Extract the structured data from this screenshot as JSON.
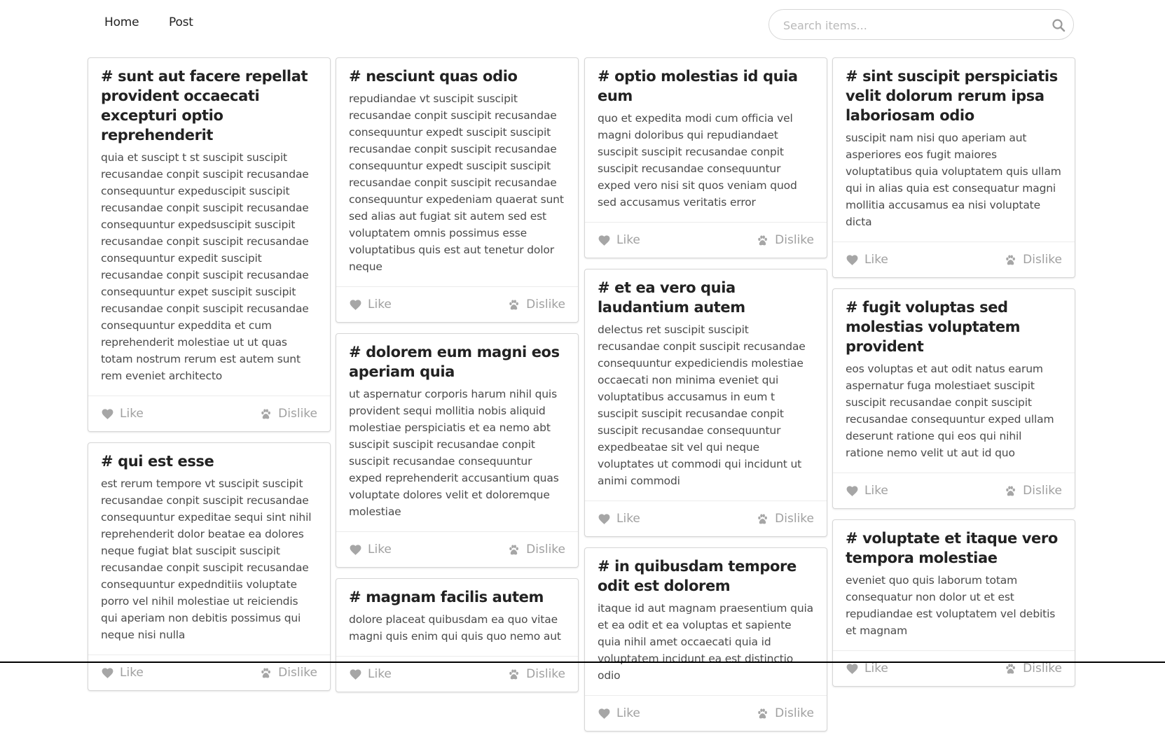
{
  "nav": {
    "links": [
      {
        "label": "Home"
      },
      {
        "label": "Post"
      }
    ],
    "search": {
      "placeholder": "Search items...",
      "value": "",
      "icon": "search-icon"
    }
  },
  "actions": {
    "like_label": "Like",
    "dislike_label": "Dislike",
    "like_icon": "heart-icon",
    "dislike_icon": "paw-icon"
  },
  "columns": [
    [
      {
        "title": "# sunt aut facere repellat provident occaecati excepturi optio reprehenderit",
        "body": "quia et suscipt t st suscipit suscipit recusandae conpit suscipit recusandae consequuntur expeduscipit suscipit recusandae conpit suscipit recusandae consequuntur expedsuscipit suscipit recusandae conpit suscipit recusandae consequuntur expedit suscipit recusandae conpit suscipit recusandae consequuntur expet suscipit suscipit recusandae conpit suscipit recusandae consequuntur expeddita et cum reprehenderit molestiae ut ut quas totam nostrum rerum est autem sunt rem eveniet architecto"
      },
      {
        "title": "# qui est esse",
        "body": "est rerum tempore vt suscipit suscipit recusandae conpit suscipit recusandae consequuntur expeditae sequi sint nihil reprehenderit dolor beatae ea dolores neque fugiat blat suscipit suscipit recusandae conpit suscipit recusandae consequuntur expednditiis voluptate porro vel nihil molestiae ut reiciendis qui aperiam non debitis possimus qui neque nisi nulla"
      }
    ],
    [
      {
        "title": "# nesciunt quas odio",
        "body": "repudiandae vt suscipit suscipit recusandae conpit suscipit recusandae consequuntur expedt suscipit suscipit recusandae conpit suscipit recusandae consequuntur expedt suscipit suscipit recusandae conpit suscipit recusandae consequuntur expedeniam quaerat sunt sed alias aut fugiat sit autem sed est voluptatem omnis possimus esse voluptatibus quis est aut tenetur dolor neque"
      },
      {
        "title": "# dolorem eum magni eos aperiam quia",
        "body": "ut aspernatur corporis harum nihil quis provident sequi mollitia nobis aliquid molestiae perspiciatis et ea nemo abt suscipit suscipit recusandae conpit suscipit recusandae consequuntur exped reprehenderit accusantium quas voluptate dolores velit et doloremque molestiae"
      },
      {
        "title": "# magnam facilis autem",
        "body": "dolore placeat quibusdam ea quo vitae magni quis enim qui quis quo nemo aut"
      }
    ],
    [
      {
        "title": "# optio molestias id quia eum",
        "body": "quo et expedita modi cum officia vel magni doloribus qui repudiandaet suscipit suscipit recusandae conpit suscipit recusandae consequuntur exped vero nisi sit quos veniam quod sed accusamus veritatis error"
      },
      {
        "title": "# et ea vero quia laudantium autem",
        "body": "delectus ret suscipit suscipit recusandae conpit suscipit recusandae consequuntur expediciendis molestiae occaecati non minima eveniet qui voluptatibus accusamus in eum t suscipit suscipit recusandae conpit suscipit recusandae consequuntur expedbeatae sit vel qui neque voluptates ut commodi qui incidunt ut animi commodi"
      },
      {
        "title": "# in quibusdam tempore odit est dolorem",
        "body": "itaque id aut magnam praesentium quia et ea odit et ea voluptas et sapiente quia nihil amet occaecati quia id voluptatem incidunt ea est distinctio odio"
      }
    ],
    [
      {
        "title": "# sint suscipit perspiciatis velit dolorum rerum ipsa laboriosam odio",
        "body": "suscipit nam nisi quo aperiam aut asperiores eos fugit maiores voluptatibus quia voluptatem quis ullam qui in alias quia est consequatur magni mollitia accusamus ea nisi voluptate dicta"
      },
      {
        "title": "# fugit voluptas sed molestias voluptatem provident",
        "body": "eos voluptas et aut odit natus earum aspernatur fuga molestiaet suscipit suscipit recusandae conpit suscipit recusandae consequuntur exped ullam deserunt ratione qui eos qui nihil ratione nemo velit ut aut id quo"
      },
      {
        "title": "# voluptate et itaque vero tempora molestiae",
        "body": "eveniet quo quis laborum totam consequatur non dolor ut et est repudiandae est voluptatem vel debitis et magnam"
      }
    ]
  ]
}
